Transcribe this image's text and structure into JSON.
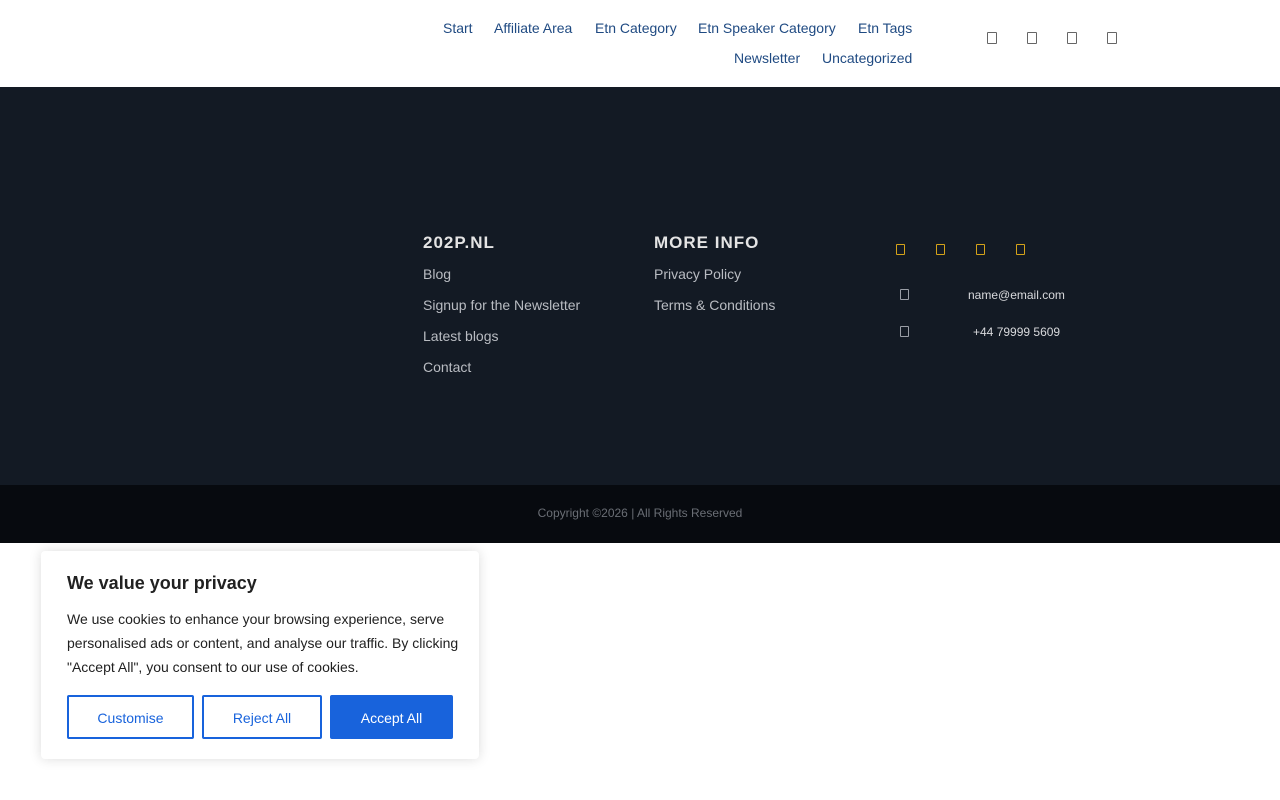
{
  "header": {
    "nav": [
      "Start",
      "Affiliate Area",
      "Etn Category",
      "Etn Speaker Category",
      "Etn Tags",
      "Newsletter",
      "Uncategorized"
    ],
    "icons": [
      "search-icon",
      "user-icon",
      "heart-icon",
      "cart-icon"
    ],
    "link_color": "#1f4a82"
  },
  "footer": {
    "background": "#131a24",
    "col1": {
      "heading": "202P.NL",
      "links": [
        "Blog",
        "Signup for the Newsletter",
        "Latest blogs",
        "Contact"
      ]
    },
    "col2": {
      "heading": "MORE INFO",
      "links": [
        "Privacy Policy",
        "Terms & Conditions"
      ]
    },
    "col3": {
      "social_icons": [
        "facebook-icon",
        "twitter-icon",
        "instagram-icon",
        "linkedin-icon"
      ],
      "social_color": "#d4a21a",
      "email": "name@email.com",
      "phone": "+44 79999 5609"
    }
  },
  "copyright": "Copyright ©2026 | All Rights Reserved",
  "cookie_banner": {
    "title": "We value your privacy",
    "text": "We use cookies to enhance your browsing experience, serve personalised ads or content, and analyse our traffic. By clicking \"Accept All\", you consent to our use of cookies.",
    "buttons": {
      "customise": "Customise",
      "reject": "Reject All",
      "accept": "Accept All"
    },
    "accent": "#1863dc"
  }
}
